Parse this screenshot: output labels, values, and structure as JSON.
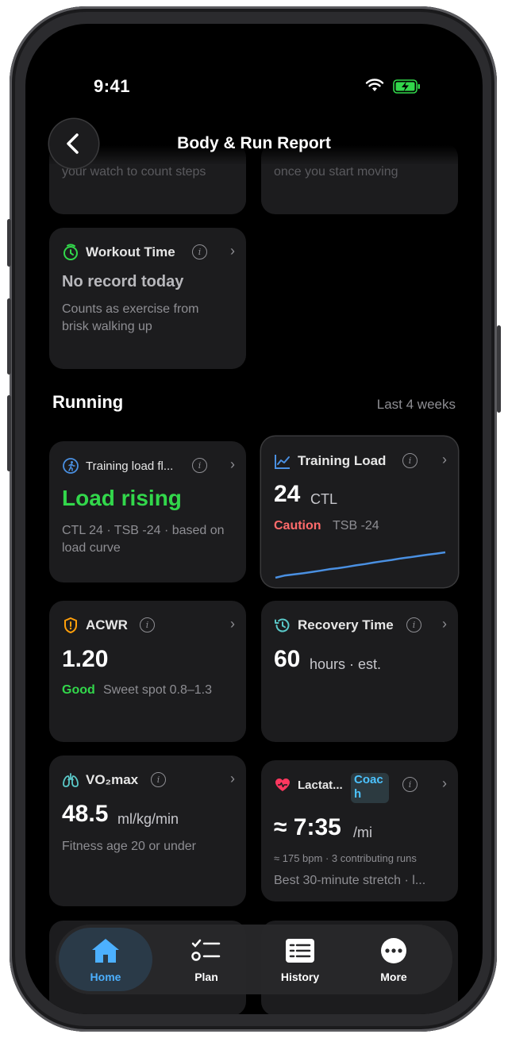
{
  "status": {
    "time": "9:41"
  },
  "header": {
    "title": "Body & Run Report"
  },
  "top_cards": {
    "left_sub": "your watch to count steps",
    "right_sub": "once you start moving"
  },
  "workout": {
    "title": "Workout Time",
    "value": "No record today",
    "desc": "Counts as exercise from brisk walking up"
  },
  "running": {
    "heading": "Running",
    "range": "Last 4 weeks"
  },
  "cards": {
    "trend": {
      "title": "Training load fl...",
      "value": "Load rising",
      "desc": "CTL 24 · TSB -24 · based on load curve"
    },
    "load": {
      "title": "Training Load",
      "value": "24",
      "unit": "CTL",
      "status": "Caution",
      "detail": "TSB -24",
      "chart": [
        3,
        4,
        4.5,
        5,
        5.6,
        6.2,
        6.9,
        7.4,
        8,
        8.7,
        9.3,
        10,
        10.6,
        11.2,
        11.9,
        12.4,
        13,
        13.6,
        14.1,
        14.7
      ]
    },
    "acwr": {
      "title": "ACWR",
      "value": "1.20",
      "status": "Good",
      "detail": "Sweet spot 0.8–1.3"
    },
    "recovery": {
      "title": "Recovery Time",
      "value": "60",
      "unit": "hours · est."
    },
    "vo2": {
      "title": "VO₂max",
      "value": "48.5",
      "unit": "ml/kg/min",
      "desc": "Fitness age 20 or under"
    },
    "lactate": {
      "title": "Lactat...",
      "badge": "Coach",
      "value": "≈ 7:35",
      "unit": "/mi",
      "detail": "≈ 175 bpm · 3 contributing runs",
      "desc": "Best 30-minute stretch · l..."
    }
  },
  "colors": {
    "green": "#32d74b",
    "orange": "#ff9f0a",
    "blue": "#4a90e2",
    "red": "#ff6b6b",
    "teal": "#5ac8c8",
    "coach_text": "#4cc3ff"
  },
  "tabs": [
    {
      "label": "Home",
      "icon": "home-icon"
    },
    {
      "label": "Plan",
      "icon": "checklist-icon"
    },
    {
      "label": "History",
      "icon": "history-icon"
    },
    {
      "label": "More",
      "icon": "more-icon"
    }
  ]
}
